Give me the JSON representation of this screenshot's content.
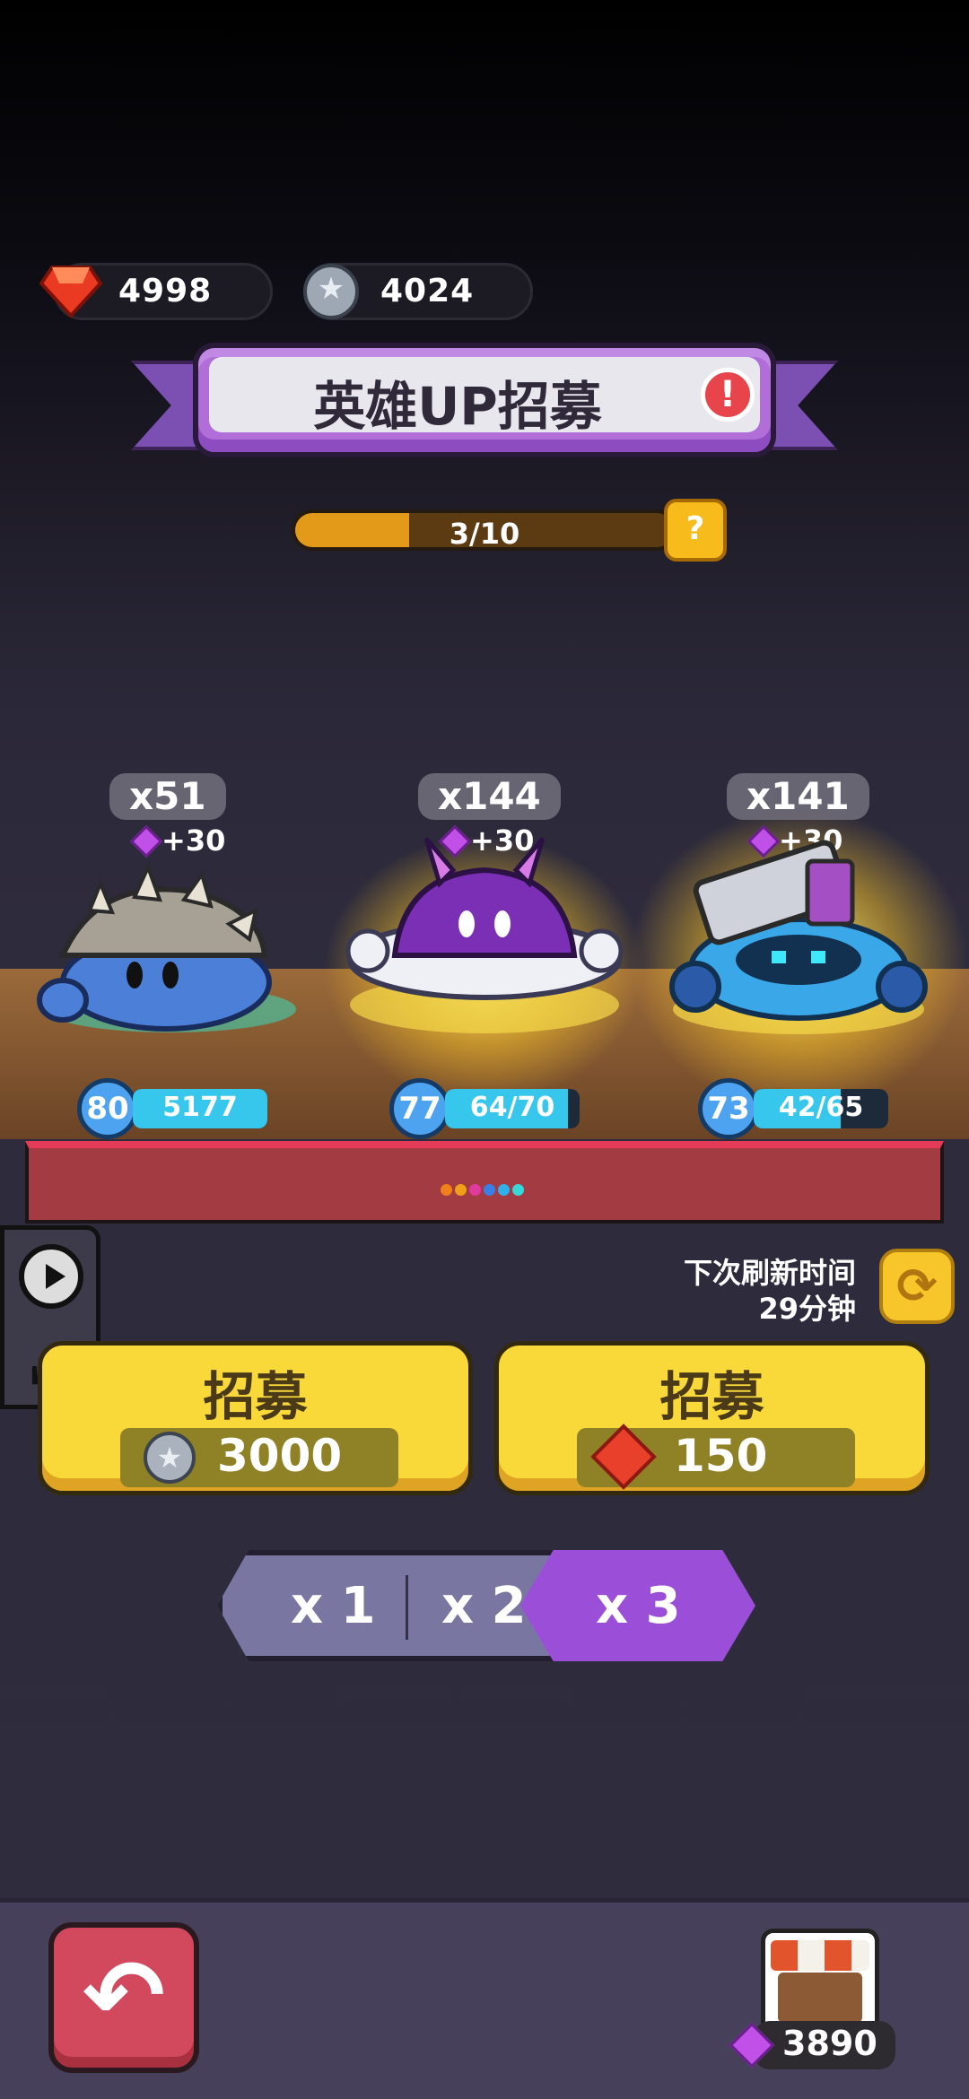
{
  "currencies": {
    "ruby": {
      "value": "4998",
      "icon": "ruby-gem-icon"
    },
    "coin": {
      "value": "4024",
      "icon": "silver-coin-icon"
    }
  },
  "banner": {
    "title": "英雄UP招募",
    "alert_icon": "!"
  },
  "progress": {
    "text": "3/10",
    "fraction": 0.3,
    "help_icon": "?"
  },
  "heroes": [
    {
      "count": "x51",
      "bonus": "+30",
      "level": "80",
      "bar_text": "5177",
      "bar_fill": 1.0
    },
    {
      "count": "x144",
      "bonus": "+30",
      "level": "77",
      "bar_text": "64/70",
      "bar_fill": 0.914
    },
    {
      "count": "x141",
      "bonus": "+30",
      "level": "73",
      "bar_text": "42/65",
      "bar_fill": 0.646
    }
  ],
  "page_dots": [
    "#f0801a",
    "#f0a018",
    "#e03aa0",
    "#3a7ee8",
    "#2fb0e8",
    "#38d8d8"
  ],
  "refresh": {
    "line1": "下次刷新时间",
    "line2": "29分钟",
    "icon": "refresh-icon"
  },
  "recruit": {
    "coin_button": {
      "label": "招募",
      "cost": "3000"
    },
    "ruby_button": {
      "label": "招募",
      "cost": "150"
    }
  },
  "multiplier": {
    "options": [
      "x 1",
      "x 2",
      "x 3"
    ],
    "selected": "x 3"
  },
  "bottom": {
    "back_icon": "back-arrow-icon",
    "shop_icon": "shop-icon",
    "shop_gems": "3890"
  },
  "colors": {
    "accent_purple": "#9b4fd9",
    "button_yellow": "#f9d93a",
    "back_red": "#d2485d"
  }
}
